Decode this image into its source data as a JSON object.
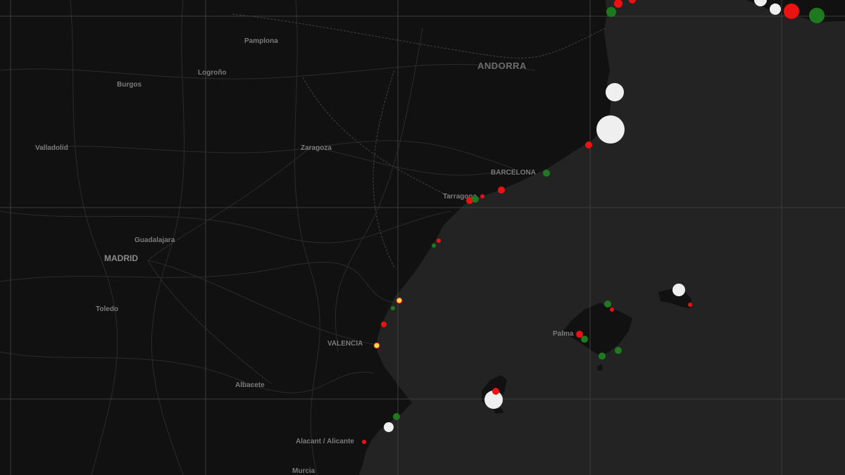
{
  "map": {
    "colors": {
      "sea": "#232323",
      "land": "#111111",
      "road": "#2c2c2c",
      "border": "#3a3a3a",
      "grid": "#3d3d3d",
      "label": "#7a7a7a",
      "marker_red": "#ee1111",
      "marker_green": "#1f7a1f",
      "marker_white": "#efefef",
      "marker_yellow": "#e8e04a"
    },
    "labels": {
      "andorra": "ANDORRA",
      "barcelona": "BARCELONA",
      "madrid": "MADRID",
      "valencia": "VALENCIA",
      "pamplona": "Pamplona",
      "logrono": "Logroño",
      "burgos": "Burgos",
      "valladolid": "Valladolid",
      "zaragoza": "Zaragoza",
      "tarragona": "Tarragona",
      "guadalajara": "Guadalajara",
      "toledo": "Toledo",
      "albacete": "Albacete",
      "alicante": "Alacant / Alicante",
      "murcia": "Murcia",
      "palma": "Palma"
    },
    "markers": [
      {
        "type": "red",
        "name": "marker-roses"
      },
      {
        "type": "green",
        "name": "marker-port-vendres"
      },
      {
        "type": "red",
        "name": "marker-north-1"
      },
      {
        "type": "red",
        "name": "marker-north-2"
      },
      {
        "type": "white",
        "name": "marker-coast-ne-1"
      },
      {
        "type": "red",
        "name": "marker-coast-ne-2"
      },
      {
        "type": "green",
        "name": "marker-coast-ne-3"
      },
      {
        "type": "white",
        "name": "marker-coast-ne-4"
      },
      {
        "type": "white",
        "name": "marker-palamos"
      },
      {
        "type": "white",
        "name": "marker-blanes"
      },
      {
        "type": "red",
        "name": "marker-maresme"
      },
      {
        "type": "green",
        "name": "marker-barcelona"
      },
      {
        "type": "red",
        "name": "marker-garraf"
      },
      {
        "type": "red",
        "name": "marker-tarragona-1"
      },
      {
        "type": "green",
        "name": "marker-tarragona-2"
      },
      {
        "type": "red",
        "name": "marker-tarragona-3"
      },
      {
        "type": "red",
        "name": "marker-ebro-1"
      },
      {
        "type": "green",
        "name": "marker-ebro-2"
      },
      {
        "type": "yellow",
        "name": "marker-castellon"
      },
      {
        "type": "green",
        "name": "marker-sagunto"
      },
      {
        "type": "red",
        "name": "marker-valencia-north"
      },
      {
        "type": "yellow",
        "name": "marker-valencia"
      },
      {
        "type": "green",
        "name": "marker-denia"
      },
      {
        "type": "white",
        "name": "marker-javea"
      },
      {
        "type": "red",
        "name": "marker-alicante"
      },
      {
        "type": "white",
        "name": "marker-ibiza"
      },
      {
        "type": "red",
        "name": "marker-ibiza-red"
      },
      {
        "type": "green",
        "name": "marker-mallorca-north"
      },
      {
        "type": "red",
        "name": "marker-mallorca-north-red"
      },
      {
        "type": "red",
        "name": "marker-palma-red"
      },
      {
        "type": "green",
        "name": "marker-palma-green"
      },
      {
        "type": "green",
        "name": "marker-mallorca-south-1"
      },
      {
        "type": "green",
        "name": "marker-mallorca-south-2"
      },
      {
        "type": "white",
        "name": "marker-menorca"
      },
      {
        "type": "red",
        "name": "marker-menorca-red"
      }
    ]
  }
}
